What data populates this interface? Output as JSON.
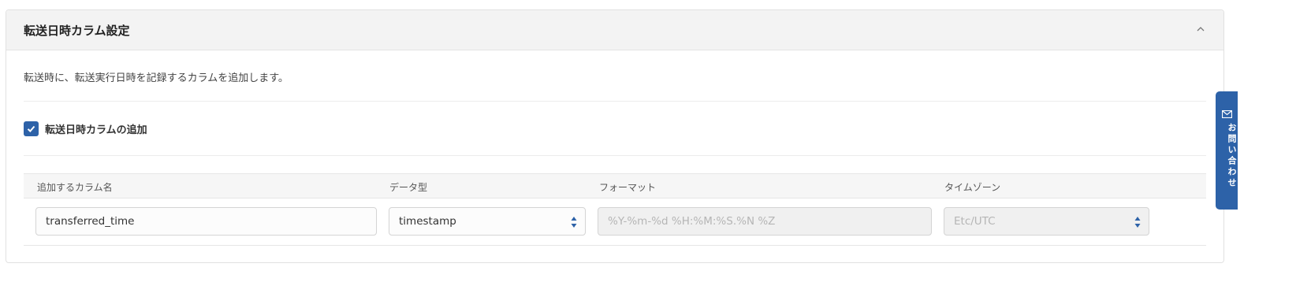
{
  "panel": {
    "title": "転送日時カラム設定",
    "description": "転送時に、転送実行日時を記録するカラムを追加します。",
    "checkbox": {
      "label": "転送日時カラムの追加",
      "checked": true
    },
    "table": {
      "headers": [
        "追加するカラム名",
        "データ型",
        "フォーマット",
        "タイムゾーン"
      ],
      "row": {
        "column_name": "transferred_time",
        "data_type": "timestamp",
        "format_placeholder": "%Y-%m-%d %H:%M:%S.%N %Z",
        "timezone": "Etc/UTC"
      }
    }
  },
  "side_tab": {
    "label": "お問い合わせ",
    "icon": "mail-icon"
  },
  "colors": {
    "accent": "#2d62a8",
    "header_bg": "#f3f3f3"
  }
}
